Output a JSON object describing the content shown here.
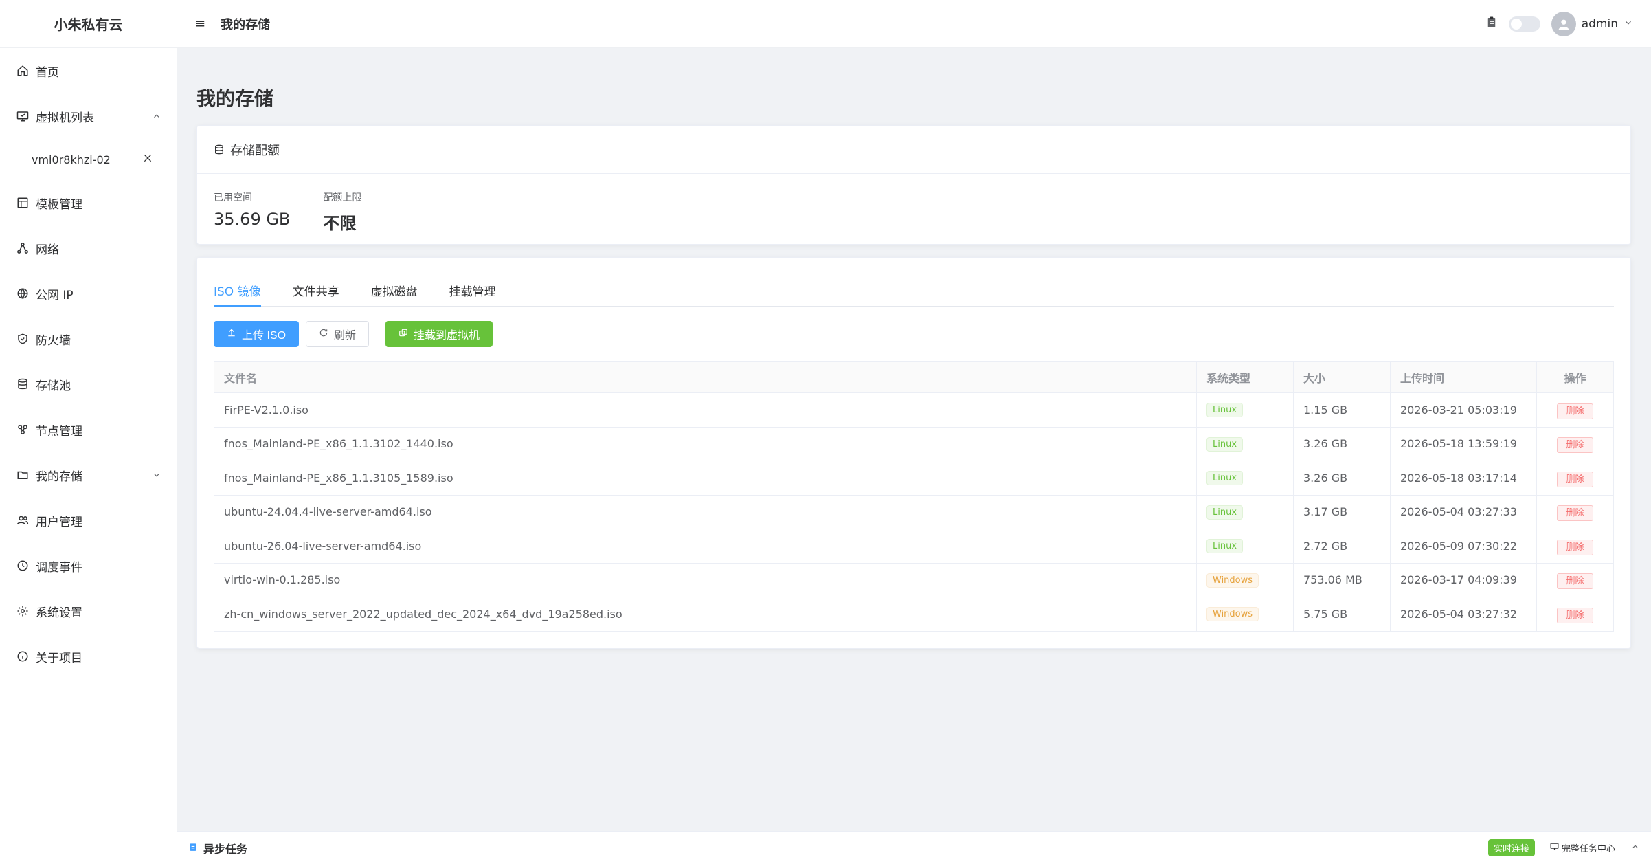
{
  "app": {
    "brand": "小朱私有云"
  },
  "sidebar": {
    "items": [
      {
        "label": "首页",
        "icon": "home-icon"
      },
      {
        "label": "虚拟机列表",
        "icon": "monitor-icon"
      },
      {
        "label": "vmi0r8khzi-02"
      },
      {
        "label": "模板管理",
        "icon": "template-icon"
      },
      {
        "label": "网络",
        "icon": "network-icon"
      },
      {
        "label": "公网 IP",
        "icon": "globe-icon"
      },
      {
        "label": "防火墙",
        "icon": "shield-icon"
      },
      {
        "label": "存储池",
        "icon": "database-icon"
      },
      {
        "label": "节点管理",
        "icon": "nodes-icon"
      },
      {
        "label": "我的存储",
        "icon": "folder-icon"
      },
      {
        "label": "用户管理",
        "icon": "users-icon"
      },
      {
        "label": "调度事件",
        "icon": "clock-icon"
      },
      {
        "label": "系统设置",
        "icon": "gear-icon"
      },
      {
        "label": "关于项目",
        "icon": "info-icon"
      }
    ]
  },
  "header": {
    "title": "我的存储",
    "username": "admin"
  },
  "page": {
    "title": "我的存储"
  },
  "quota": {
    "title": "存储配额",
    "used_label": "已用空间",
    "used_value": "35.69 GB",
    "limit_label": "配额上限",
    "limit_value": "不限"
  },
  "tabs": [
    "ISO 镜像",
    "文件共享",
    "虚拟磁盘",
    "挂载管理"
  ],
  "toolbar": {
    "upload": "上传 ISO",
    "refresh": "刷新",
    "mount": "挂载到虚拟机"
  },
  "table": {
    "headers": [
      "文件名",
      "系统类型",
      "大小",
      "上传时间",
      "操作"
    ],
    "rows": [
      {
        "name": "FirPE-V2.1.0.iso",
        "type": "Linux",
        "size": "1.15 GB",
        "time": "2026-03-21 05:03:19",
        "action": "删除"
      },
      {
        "name": "fnos_Mainland-PE_x86_1.1.3102_1440.iso",
        "type": "Linux",
        "size": "3.26 GB",
        "time": "2026-05-18 13:59:19",
        "action": "删除"
      },
      {
        "name": "fnos_Mainland-PE_x86_1.1.3105_1589.iso",
        "type": "Linux",
        "size": "3.26 GB",
        "time": "2026-05-18 03:17:14",
        "action": "删除"
      },
      {
        "name": "ubuntu-24.04.4-live-server-amd64.iso",
        "type": "Linux",
        "size": "3.17 GB",
        "time": "2026-05-04 03:27:33",
        "action": "删除"
      },
      {
        "name": "ubuntu-26.04-live-server-amd64.iso",
        "type": "Linux",
        "size": "2.72 GB",
        "time": "2026-05-09 07:30:22",
        "action": "删除"
      },
      {
        "name": "virtio-win-0.1.285.iso",
        "type": "Windows",
        "size": "753.06 MB",
        "time": "2026-03-17 04:09:39",
        "action": "删除"
      },
      {
        "name": "zh-cn_windows_server_2022_updated_dec_2024_x64_dvd_19a258ed.iso",
        "type": "Windows",
        "size": "5.75 GB",
        "time": "2026-05-04 03:27:32",
        "action": "删除"
      }
    ]
  },
  "bottombar": {
    "title": "异步任务",
    "live": "实时连接",
    "task_center": "完整任务中心"
  },
  "colors": {
    "primary": "#409eff",
    "success": "#67c23a",
    "danger": "#f56c6c",
    "warning": "#e6a23c"
  }
}
